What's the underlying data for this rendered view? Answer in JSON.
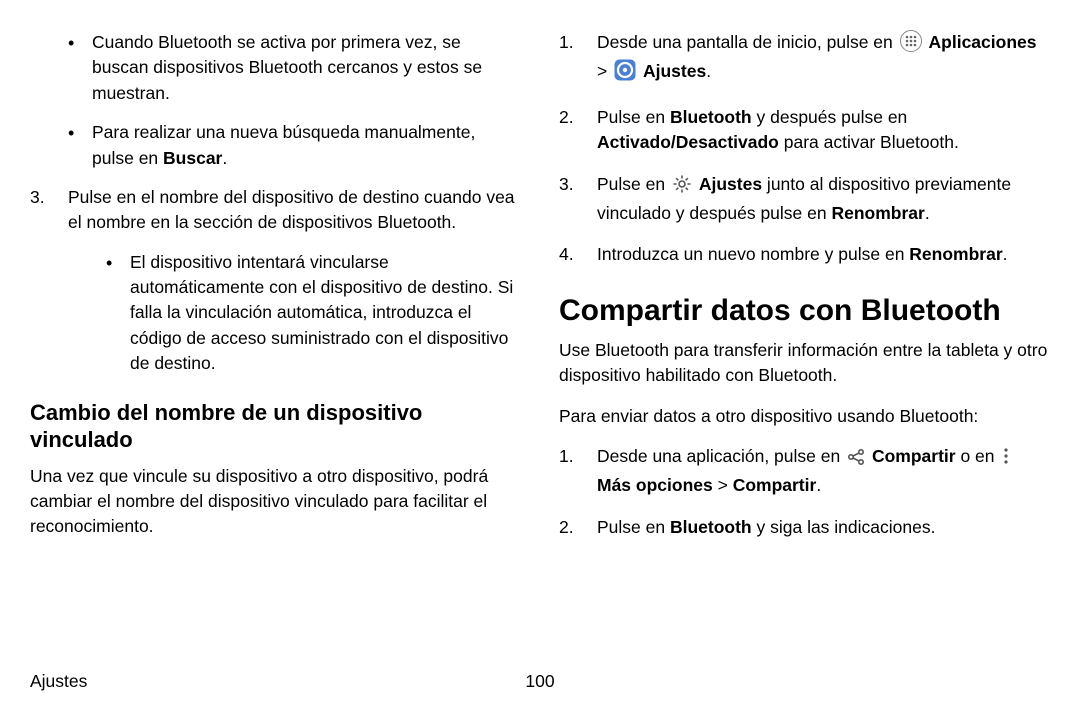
{
  "left": {
    "bullet1_a": "Cuando Bluetooth se activa por primera vez, se buscan dispositivos Bluetooth cercanos y estos se muestran.",
    "bullet2_a": "Para realizar una nueva búsqueda manualmente, pulse en ",
    "bullet2_b": "Buscar",
    "bullet2_c": ".",
    "step3_num": "3.",
    "step3_text": "Pulse en el nombre del dispositivo de destino cuando vea el nombre en la sección de dispositivos Bluetooth.",
    "step3_sub": "El dispositivo intentará vincularse automáticamente con el dispositivo de destino. Si falla la vinculación automática, introduzca el código de acceso suministrado con el dispositivo de destino.",
    "subhead": "Cambio del nombre de un dispositivo vinculado",
    "subintro": "Una vez que vincule su dispositivo a otro dispositivo, podrá cambiar el nombre del dispositivo vinculado para facilitar el reconocimiento."
  },
  "right": {
    "r1_num": "1.",
    "r1_a": "Desde una pantalla de inicio, pulse en ",
    "r1_apps": "Aplicaciones",
    "r1_sep": " > ",
    "r1_settings": "Ajustes",
    "r1_end": ".",
    "r2_num": "2.",
    "r2_a": "Pulse en ",
    "r2_b": "Bluetooth",
    "r2_c": " y después pulse en ",
    "r2_d": "Activado/Desactivado",
    "r2_e": " para activar Bluetooth.",
    "r3_num": "3.",
    "r3_a": "Pulse en ",
    "r3_b": "Ajustes",
    "r3_c": " junto al dispositivo previamente vinculado y después pulse en ",
    "r3_d": "Renombrar",
    "r3_e": ".",
    "r4_num": "4.",
    "r4_a": "Introduzca un nuevo nombre y pulse en ",
    "r4_b": "Renombrar",
    "r4_c": ".",
    "mainhead": "Compartir datos con Bluetooth",
    "main_intro": "Use Bluetooth para transferir información entre la tableta y otro dispositivo habilitado con Bluetooth.",
    "main_para": "Para enviar datos a otro dispositivo usando Bluetooth:",
    "s1_num": "1.",
    "s1_a": "Desde una aplicación, pulse en ",
    "s1_b": "Compartir",
    "s1_c": " o en ",
    "s1_d": "Más opciones",
    "s1_sep": " > ",
    "s1_e": "Compartir",
    "s1_f": ".",
    "s2_num": "2.",
    "s2_a": "Pulse en ",
    "s2_b": "Bluetooth",
    "s2_c": " y siga las indicaciones."
  },
  "footer": {
    "section": "Ajustes",
    "page": "100"
  }
}
